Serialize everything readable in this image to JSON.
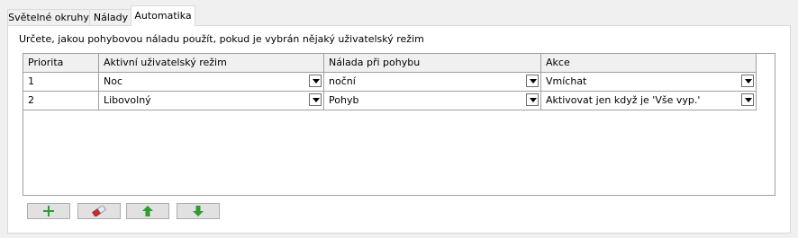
{
  "tabs": [
    {
      "label": "Světelné okruhy"
    },
    {
      "label": "Nálady"
    },
    {
      "label": "Automatika",
      "active": true
    }
  ],
  "description": "Určete, jakou pohybovou náladu použít, pokud je vybrán nějaký uživatelský režim",
  "table": {
    "columns": [
      "Priorita",
      "Aktivní uživatelský režim",
      "Nálada při pohybu",
      "Akce"
    ],
    "rows": [
      {
        "priority": "1",
        "mode": "Noc",
        "mood": "noční",
        "action": "Vmíchat"
      },
      {
        "priority": "2",
        "mode": "Libovolný",
        "mood": "Pohyb",
        "action": "Aktivovat jen když je 'Vše vyp.'"
      }
    ]
  },
  "toolbar": {
    "buttons": [
      {
        "name": "add",
        "icon": "plus-icon",
        "color": "#2e9d2e"
      },
      {
        "name": "clear",
        "icon": "eraser-icon",
        "color": "#d22a2a"
      },
      {
        "name": "move-up",
        "icon": "arrow-up-icon",
        "color": "#2e9d2e"
      },
      {
        "name": "move-down",
        "icon": "arrow-down-icon",
        "color": "#2e9d2e"
      }
    ]
  }
}
